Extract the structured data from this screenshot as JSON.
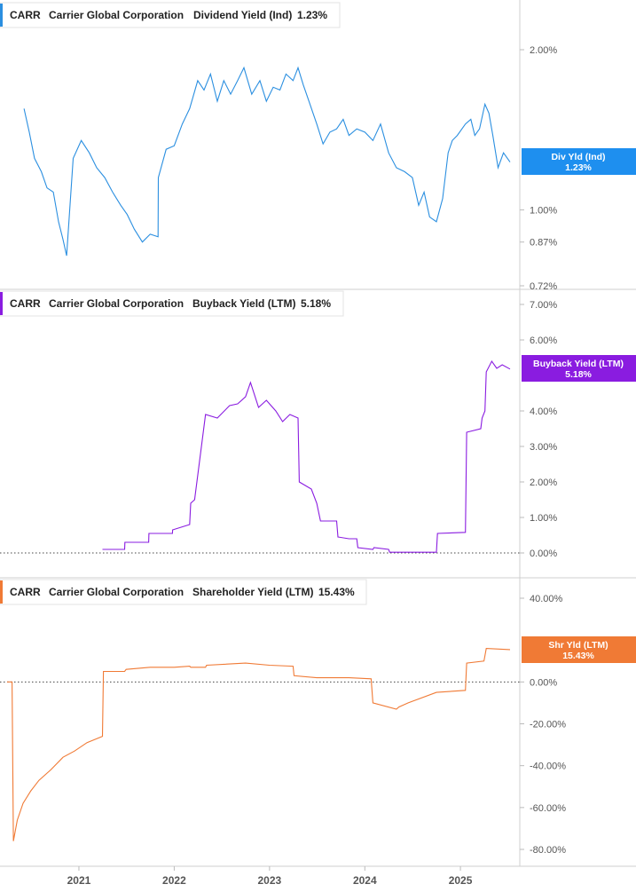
{
  "chart_data": [
    {
      "type": "line",
      "ticker": "CARR",
      "company": "Carrier Global Corporation",
      "metric": "Dividend Yield (Ind)",
      "current_value": "1.23%",
      "tag_label": "Div Yld (Ind)",
      "tag_value": "1.23%",
      "color": "#2b8fe0",
      "scale": "log",
      "ylim": [
        0.0072,
        0.025
      ],
      "yticks": [
        {
          "v": 0.02,
          "label": "2.00%"
        },
        {
          "v": 0.01,
          "label": "1.00%"
        },
        {
          "v": 0.0087,
          "label": "0.87%"
        },
        {
          "v": 0.0072,
          "label": "0.72%"
        }
      ],
      "series": [
        {
          "x": [
            "2020-06-05",
            "2020-06-25",
            "2020-07-15",
            "2020-08-10",
            "2020-09-01",
            "2020-09-25",
            "2020-10-15",
            "2020-11-01",
            "2020-11-15",
            "2020-12-10",
            "2021-01-10",
            "2021-02-10",
            "2021-03-10",
            "2021-04-10",
            "2021-05-10",
            "2021-06-10",
            "2021-07-05",
            "2021-08-01",
            "2021-09-01",
            "2021-10-01",
            "2021-10-31",
            "2021-11-01",
            "2021-12-01",
            "2022-01-01",
            "2022-02-01",
            "2022-03-01",
            "2022-04-01",
            "2022-04-25",
            "2022-05-20",
            "2022-06-15",
            "2022-07-10",
            "2022-08-05",
            "2022-09-01",
            "2022-09-25",
            "2022-10-25",
            "2022-11-25",
            "2022-12-20",
            "2023-01-15",
            "2023-02-10",
            "2023-03-05",
            "2023-04-01",
            "2023-04-20",
            "2023-05-10",
            "2023-06-01",
            "2023-07-01",
            "2023-07-25",
            "2023-08-20",
            "2023-09-15",
            "2023-10-10",
            "2023-11-01",
            "2023-12-01",
            "2024-01-01",
            "2024-02-01",
            "2024-03-01",
            "2024-04-01",
            "2024-05-01",
            "2024-06-01",
            "2024-07-01",
            "2024-07-25",
            "2024-08-15",
            "2024-09-05",
            "2024-10-01",
            "2024-10-25",
            "2024-11-15",
            "2024-12-01",
            "2024-12-20",
            "2025-01-20",
            "2025-02-10",
            "2025-02-25",
            "2025-03-15",
            "2025-04-05",
            "2025-04-20",
            "2025-05-05",
            "2025-05-25",
            "2025-06-15",
            "2025-07-10"
          ],
          "values": [
            0.0155,
            0.014,
            0.0125,
            0.0118,
            0.011,
            0.0108,
            0.0095,
            0.0088,
            0.0082,
            0.0125,
            0.0135,
            0.0128,
            0.012,
            0.0115,
            0.0108,
            0.0102,
            0.0098,
            0.0092,
            0.0087,
            0.009,
            0.0089,
            0.0115,
            0.013,
            0.0132,
            0.0145,
            0.0155,
            0.0175,
            0.0168,
            0.018,
            0.016,
            0.0175,
            0.0165,
            0.0175,
            0.0185,
            0.0165,
            0.0175,
            0.016,
            0.017,
            0.0168,
            0.018,
            0.0175,
            0.0185,
            0.0172,
            0.016,
            0.0145,
            0.0133,
            0.014,
            0.0142,
            0.0148,
            0.0138,
            0.0142,
            0.014,
            0.0135,
            0.0145,
            0.0128,
            0.012,
            0.0118,
            0.0115,
            0.0102,
            0.0108,
            0.0097,
            0.0095,
            0.0105,
            0.0128,
            0.0135,
            0.0138,
            0.0145,
            0.0148,
            0.0138,
            0.0142,
            0.0158,
            0.0152,
            0.0138,
            0.012,
            0.0128,
            0.0123
          ]
        }
      ]
    },
    {
      "type": "line",
      "ticker": "CARR",
      "company": "Carrier Global Corporation",
      "metric": "Buyback Yield (LTM)",
      "current_value": "5.18%",
      "tag_label": "Buyback Yield (LTM)",
      "tag_value": "5.18%",
      "color": "#8a1ce0",
      "scale": "linear",
      "ylim": [
        0,
        0.07
      ],
      "yticks": [
        {
          "v": 0.07,
          "label": "7.00%"
        },
        {
          "v": 0.06,
          "label": "6.00%"
        },
        {
          "v": 0.04,
          "label": "4.00%"
        },
        {
          "v": 0.03,
          "label": "3.00%"
        },
        {
          "v": 0.02,
          "label": "2.00%"
        },
        {
          "v": 0.01,
          "label": "1.00%"
        },
        {
          "v": 0.0,
          "label": "0.00%"
        }
      ],
      "series": [
        {
          "x": [
            "2021-04-01",
            "2021-06-25",
            "2021-06-26",
            "2021-09-25",
            "2021-09-26",
            "2021-12-25",
            "2021-12-26",
            "2022-03-01",
            "2022-03-05",
            "2022-03-20",
            "2022-05-01",
            "2022-06-15",
            "2022-08-01",
            "2022-09-01",
            "2022-10-01",
            "2022-10-20",
            "2022-11-20",
            "2022-12-20",
            "2023-01-25",
            "2023-02-20",
            "2023-03-20",
            "2023-04-20",
            "2023-04-25",
            "2023-06-10",
            "2023-07-01",
            "2023-07-15",
            "2023-09-15",
            "2023-09-20",
            "2023-11-01",
            "2023-12-01",
            "2023-12-05",
            "2024-02-01",
            "2024-02-05",
            "2024-04-01",
            "2024-04-05",
            "2024-10-01",
            "2024-10-05",
            "2025-01-20",
            "2025-01-25",
            "2025-03-20",
            "2025-03-25",
            "2025-04-05",
            "2025-04-10",
            "2025-05-01",
            "2025-05-20",
            "2025-06-10",
            "2025-07-10"
          ],
          "values": [
            0.001,
            0.001,
            0.003,
            0.003,
            0.0055,
            0.0055,
            0.0065,
            0.008,
            0.014,
            0.015,
            0.039,
            0.038,
            0.0415,
            0.042,
            0.044,
            0.048,
            0.041,
            0.043,
            0.04,
            0.037,
            0.039,
            0.038,
            0.02,
            0.018,
            0.014,
            0.009,
            0.009,
            0.0045,
            0.004,
            0.004,
            0.0015,
            0.001,
            0.0015,
            0.001,
            0.0002,
            0.0002,
            0.0055,
            0.0058,
            0.034,
            0.035,
            0.038,
            0.04,
            0.051,
            0.054,
            0.052,
            0.053,
            0.0518
          ]
        }
      ]
    },
    {
      "type": "line",
      "ticker": "CARR",
      "company": "Carrier Global Corporation",
      "metric": "Shareholder Yield (LTM)",
      "current_value": "15.43%",
      "tag_label": "Shr Yld (LTM)",
      "tag_value": "15.43%",
      "color": "#f07a35",
      "scale": "linear",
      "ylim": [
        -0.8,
        0.4
      ],
      "yticks": [
        {
          "v": 0.4,
          "label": "40.00%"
        },
        {
          "v": 0.0,
          "label": "0.00%"
        },
        {
          "v": -0.2,
          "label": "-20.00%"
        },
        {
          "v": -0.4,
          "label": "-40.00%"
        },
        {
          "v": -0.6,
          "label": "-60.00%"
        },
        {
          "v": -0.8,
          "label": "-80.00%"
        }
      ],
      "series": [
        {
          "x": [
            "2020-04-01",
            "2020-04-20",
            "2020-04-25",
            "2020-05-10",
            "2020-06-01",
            "2020-07-01",
            "2020-08-01",
            "2020-09-15",
            "2020-11-01",
            "2020-12-15",
            "2021-02-01",
            "2021-04-01",
            "2021-04-05",
            "2021-06-25",
            "2021-07-01",
            "2021-10-01",
            "2021-12-30",
            "2022-01-01",
            "2022-03-01",
            "2022-03-05",
            "2022-05-01",
            "2022-05-05",
            "2022-10-01",
            "2023-01-01",
            "2023-04-01",
            "2023-04-05",
            "2023-07-01",
            "2023-11-01",
            "2024-01-25",
            "2024-02-01",
            "2024-05-01",
            "2024-05-10",
            "2024-06-15",
            "2024-10-01",
            "2025-01-20",
            "2025-01-25",
            "2025-04-01",
            "2025-04-10",
            "2025-07-10"
          ],
          "values": [
            0.0,
            0.0,
            -0.76,
            -0.66,
            -0.58,
            -0.52,
            -0.47,
            -0.42,
            -0.36,
            -0.33,
            -0.29,
            -0.26,
            0.05,
            0.05,
            0.06,
            0.07,
            0.07,
            0.07,
            0.075,
            0.07,
            0.07,
            0.08,
            0.09,
            0.08,
            0.075,
            0.03,
            0.02,
            0.02,
            0.015,
            -0.1,
            -0.13,
            -0.12,
            -0.1,
            -0.05,
            -0.04,
            0.09,
            0.1,
            0.16,
            0.1543
          ]
        }
      ]
    }
  ],
  "x_axis": {
    "ticks": [
      {
        "date": "2021-01-01",
        "label": "2021"
      },
      {
        "date": "2022-01-01",
        "label": "2022"
      },
      {
        "date": "2023-01-01",
        "label": "2023"
      },
      {
        "date": "2024-01-01",
        "label": "2024"
      },
      {
        "date": "2025-01-01",
        "label": "2025"
      }
    ]
  },
  "colors": {
    "grid": "#e6e6e6",
    "divider": "#cfcfcf",
    "zero_line": "#444444"
  }
}
